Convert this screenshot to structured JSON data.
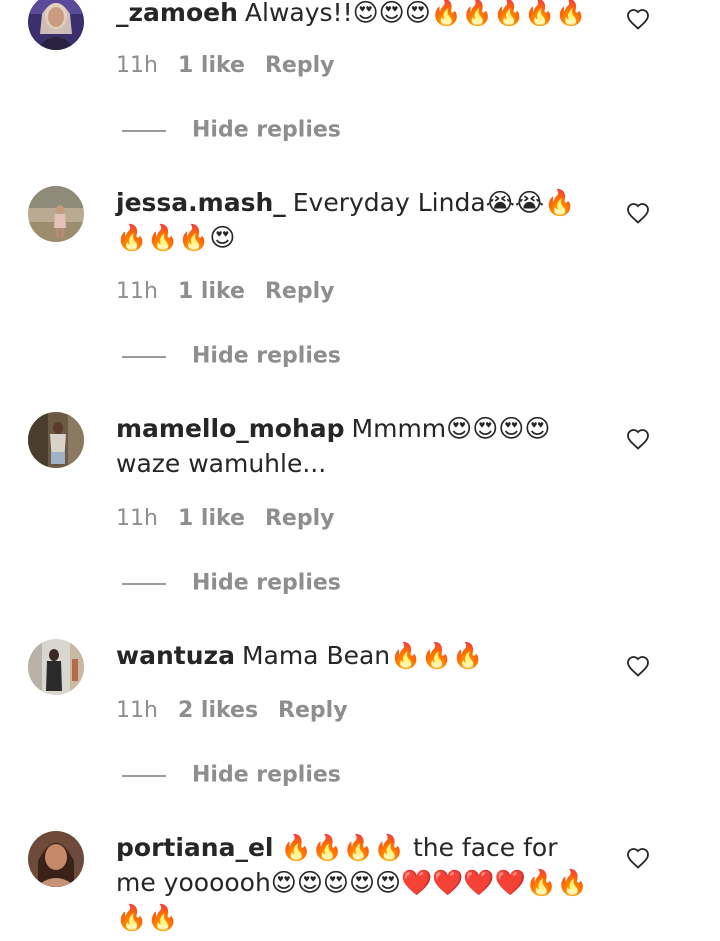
{
  "comments": [
    {
      "username": "_zamoeh",
      "text": "Always!!😍😍😍🔥🔥🔥🔥🔥",
      "time": "11h",
      "likes": "1 like",
      "reply": "Reply",
      "hide_replies": "Hide replies"
    },
    {
      "username": "jessa.mash_",
      "text": "Everyday Linda😭😭🔥🔥🔥🔥😍",
      "time": "11h",
      "likes": "1 like",
      "reply": "Reply",
      "hide_replies": "Hide replies"
    },
    {
      "username": "mamello_mohap",
      "text": "Mmmm😍😍😍😍 waze wamuhle...",
      "time": "11h",
      "likes": "1 like",
      "reply": "Reply",
      "hide_replies": "Hide replies"
    },
    {
      "username": "wantuza",
      "text": "Mama Bean🔥🔥🔥",
      "time": "11h",
      "likes": "2 likes",
      "reply": "Reply",
      "hide_replies": "Hide replies"
    },
    {
      "username": "portiana_el",
      "text": "🔥🔥🔥🔥 the face for me yoooooh😍😍😍😍😍❤️❤️❤️❤️🔥🔥🔥🔥"
    }
  ],
  "icons": {
    "like": "heart-outline-icon"
  },
  "colors": {
    "text": "#262626",
    "secondary": "#8e8e8e"
  }
}
